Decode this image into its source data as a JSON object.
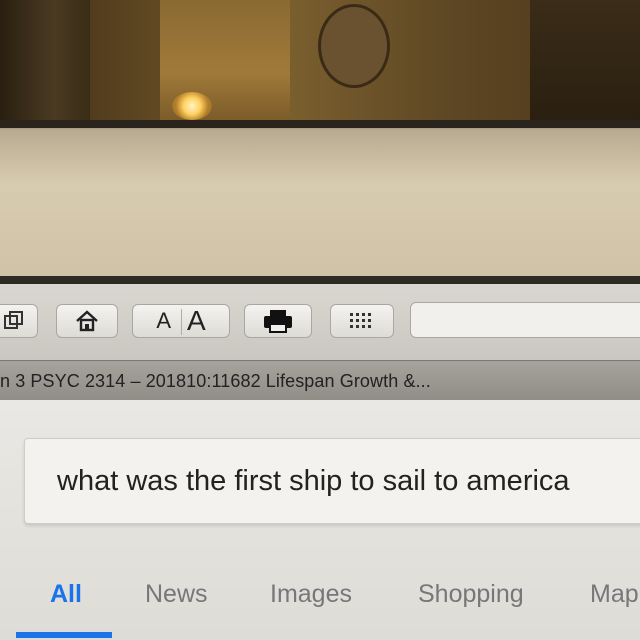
{
  "toolbar": {
    "buttons": [
      {
        "icon": "tabs-icon"
      },
      {
        "icon": "home-icon"
      },
      {
        "icon": "print-icon"
      },
      {
        "icon": "apps-grid-icon"
      }
    ],
    "font_small_label": "A",
    "font_large_label": "A"
  },
  "tab": {
    "title": "n 3 PSYC 2314 – 201810:11682 Lifespan Growth &..."
  },
  "search": {
    "query": "what was the first ship to sail to america"
  },
  "nav": {
    "tabs": [
      {
        "label": "All",
        "active": true
      },
      {
        "label": "News",
        "active": false
      },
      {
        "label": "Images",
        "active": false
      },
      {
        "label": "Shopping",
        "active": false
      },
      {
        "label": "Map",
        "active": false
      }
    ]
  },
  "colors": {
    "accent": "#1a73e8",
    "inactive_tab": "#777777"
  }
}
